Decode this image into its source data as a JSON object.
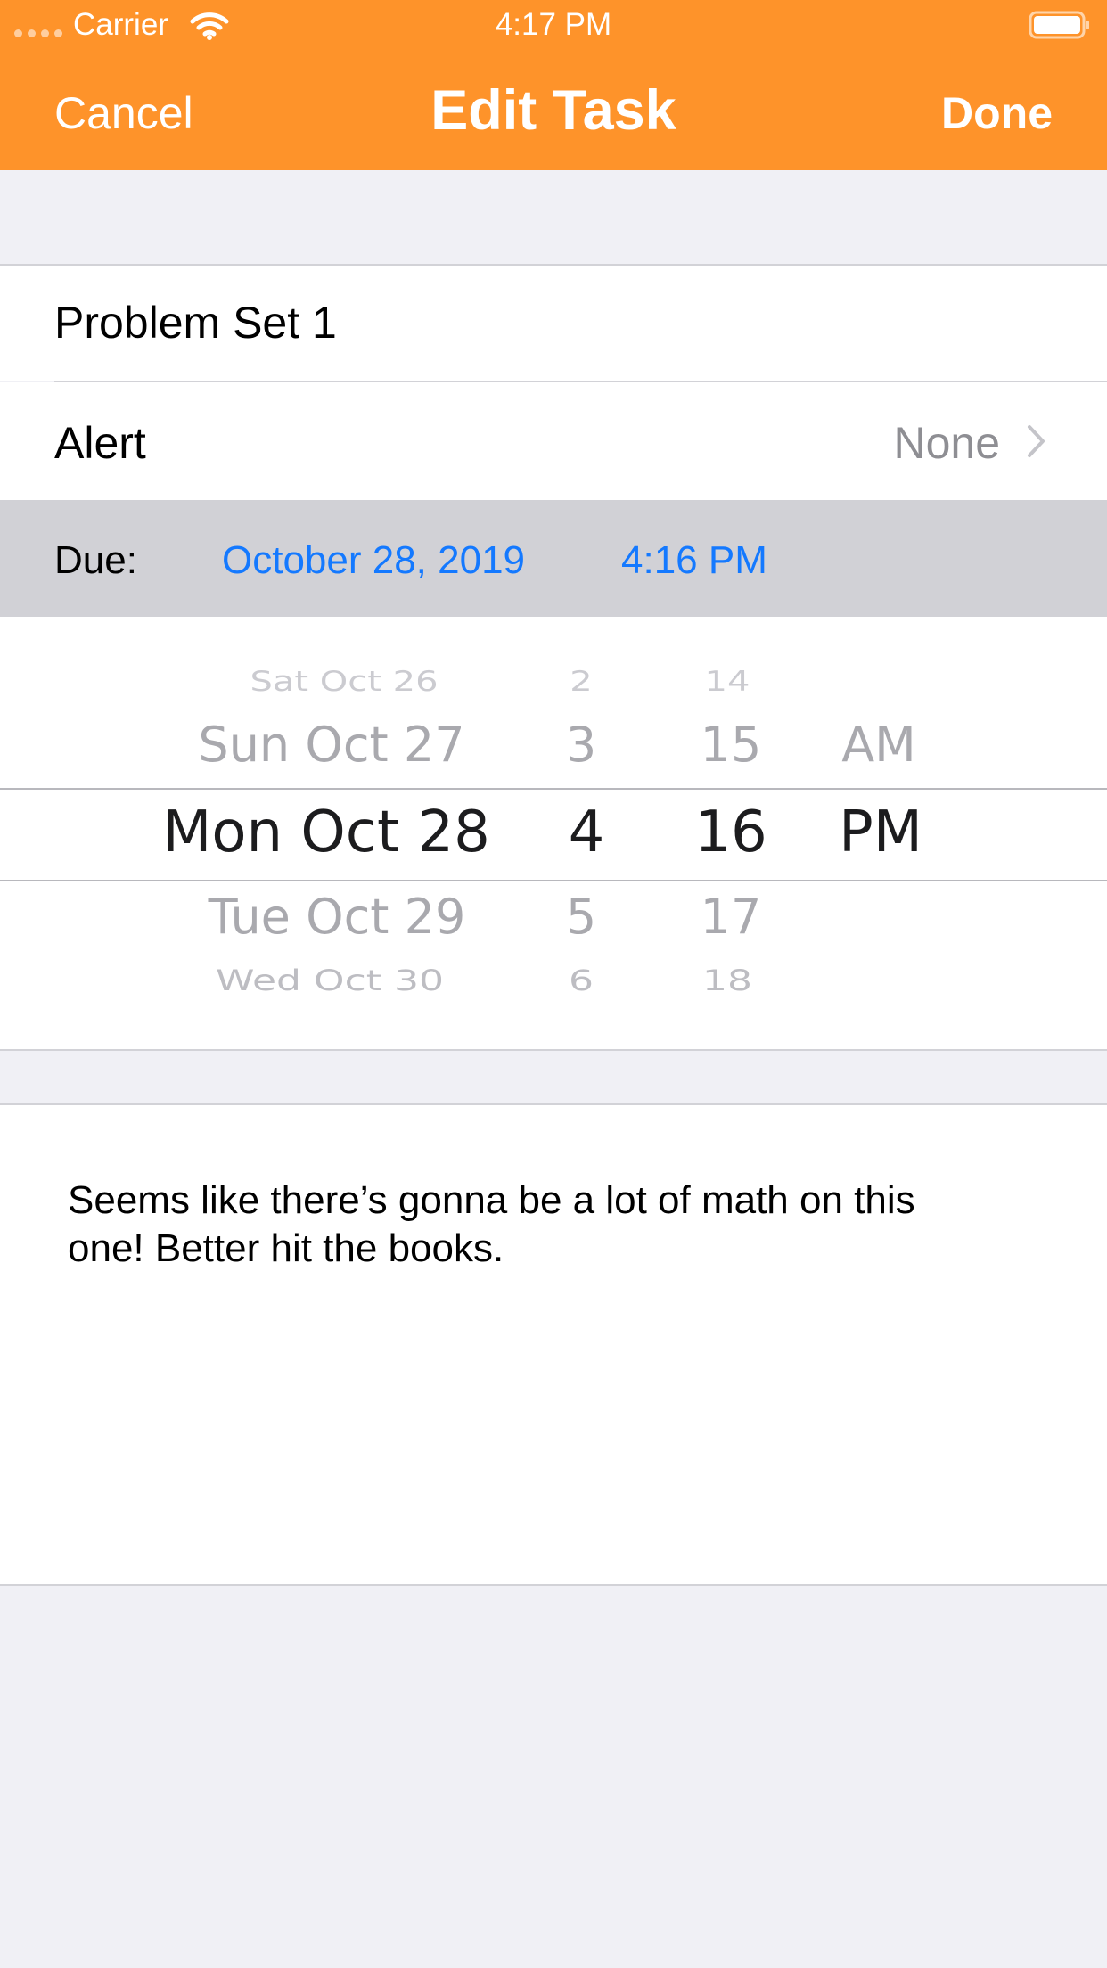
{
  "status_bar": {
    "carrier": "Carrier",
    "time": "4:17 PM"
  },
  "nav": {
    "cancel_label": "Cancel",
    "title": "Edit Task",
    "done_label": "Done"
  },
  "task": {
    "title": "Problem Set 1",
    "alert_label": "Alert",
    "alert_value": "None",
    "due_label": "Due:",
    "due_date": "October 28, 2019",
    "due_time": "4:16 PM",
    "notes": "Seems like there’s gonna be a lot of math on this one! Better hit the books."
  },
  "picker": {
    "dates": [
      "Sat Oct 26",
      "Sun Oct 27",
      "Mon Oct 28",
      "Tue Oct 29",
      "Wed Oct 30"
    ],
    "hours": [
      "2",
      "3",
      "4",
      "5",
      "6"
    ],
    "minutes": [
      "14",
      "15",
      "16",
      "17",
      "18"
    ],
    "periods": [
      "AM",
      "PM"
    ],
    "selected": {
      "date": "Mon Oct 28",
      "hour": "4",
      "minute": "16",
      "period": "PM"
    }
  },
  "colors": {
    "nav_background": "#fe932a",
    "accent_blue": "#1479ff",
    "secondary_text": "#8e8e93",
    "group_background": "#f0f0f5",
    "due_row_background": "#d1d1d6"
  },
  "icons": {
    "wifi": "wifi-icon",
    "battery": "battery-icon",
    "chevron": "chevron-right-icon"
  }
}
